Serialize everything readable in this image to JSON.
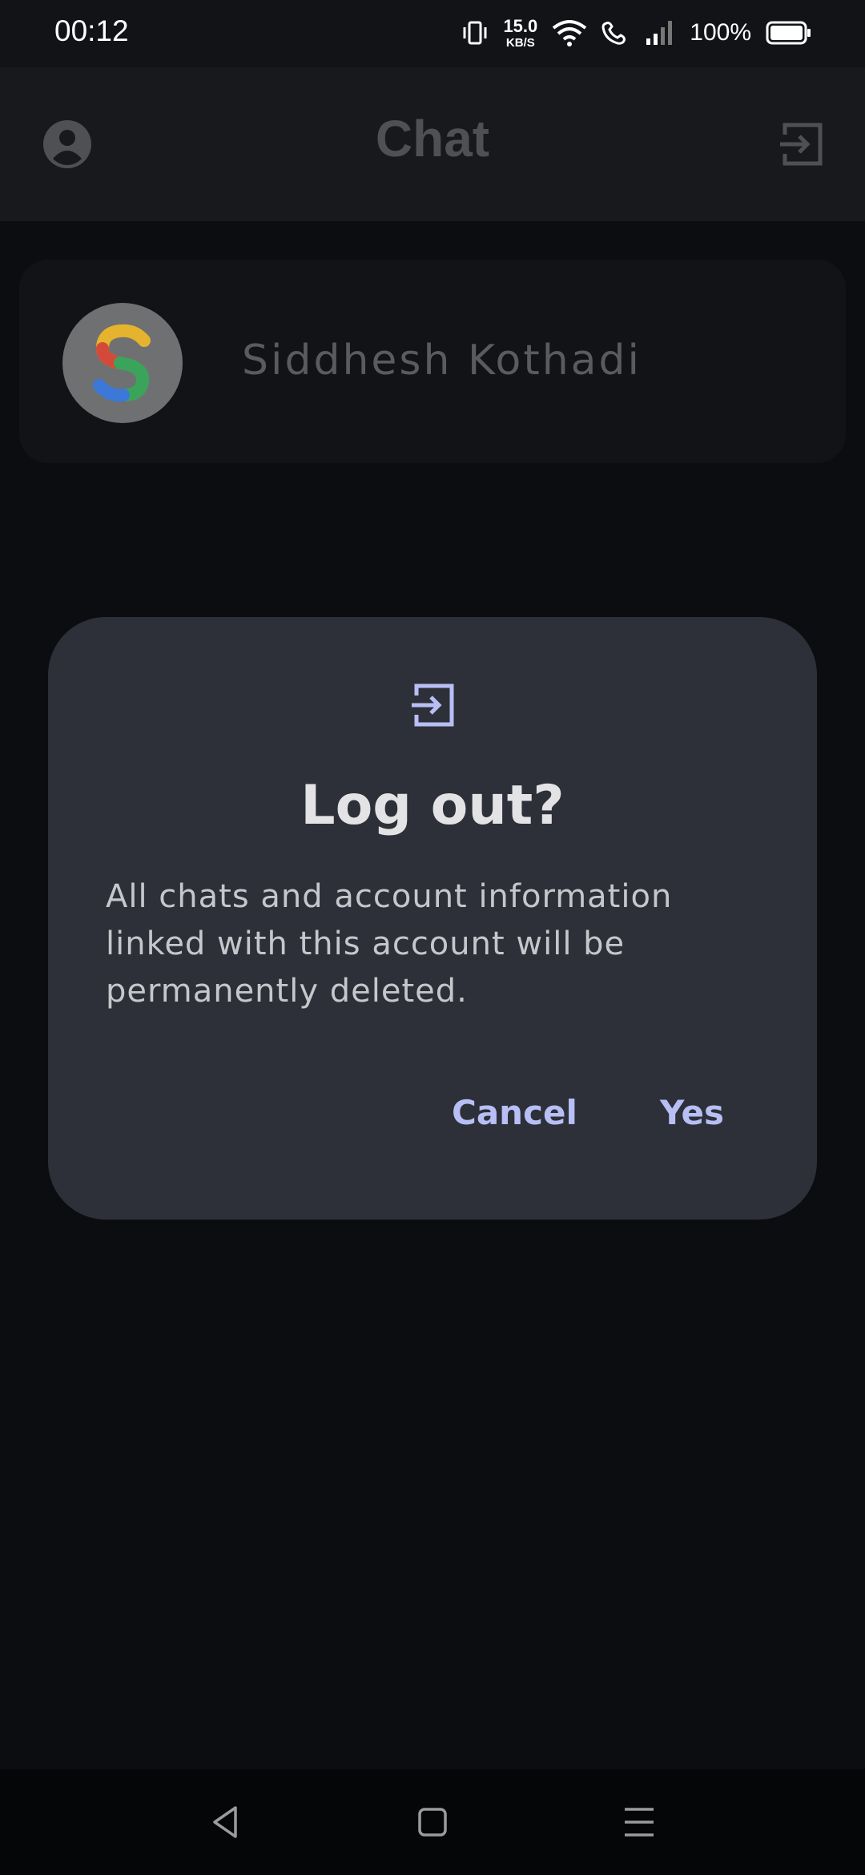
{
  "status_bar": {
    "time": "00:12",
    "net_speed_value": "15.0",
    "net_speed_unit": "KB/S",
    "battery": "100%"
  },
  "app_bar": {
    "title": "Chat"
  },
  "chats": [
    {
      "name": "Siddhesh Kothadi",
      "avatar_letter": "S"
    }
  ],
  "dialog": {
    "title": "Log out?",
    "body": "All chats and account information linked with this account will be permanently deleted.",
    "cancel_label": "Cancel",
    "confirm_label": "Yes"
  },
  "icons": {
    "profile": "account-circle-icon",
    "logout": "logout-icon",
    "nav_back": "back-triangle-icon",
    "nav_home": "home-square-icon",
    "nav_menu": "menu-lines-icon"
  },
  "colors": {
    "background": "#0b0d11",
    "app_bar": "#17191d",
    "dialog_bg": "#2d3038",
    "accent": "#b8bff5",
    "title_muted": "#4e5054"
  }
}
